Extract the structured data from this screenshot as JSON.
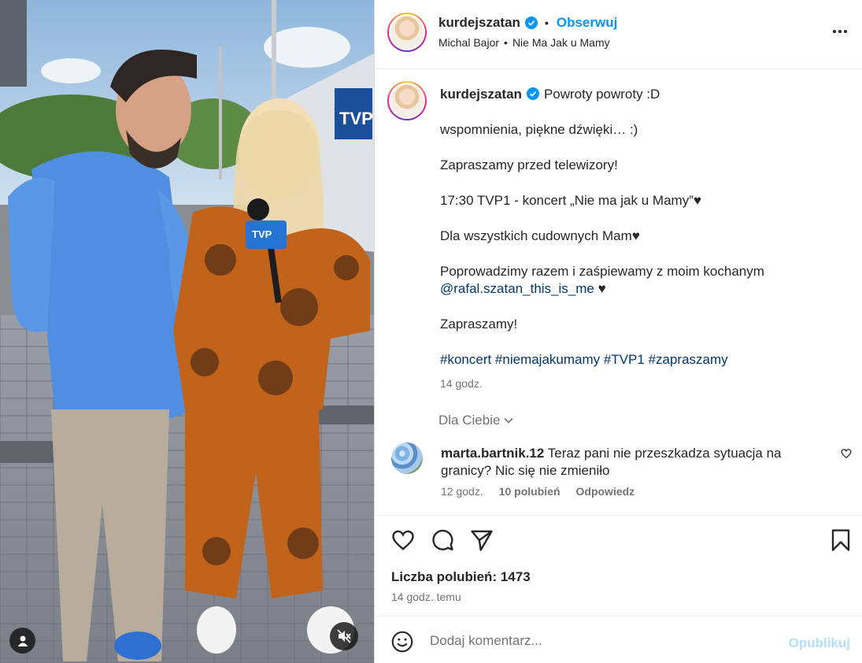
{
  "post": {
    "username": "kurdejszatan",
    "follow_label": "Obserwuj",
    "audio_artist": "Michal Bajor",
    "audio_title": "Nie Ma Jak u Mamy",
    "more_icon": "more-horizontal-icon"
  },
  "media": {
    "type": "video",
    "tag_icon": "person-tag-icon",
    "mute_icon": "muted-speaker-icon",
    "logo_text": "TVP",
    "mic_text": "TVP"
  },
  "caption": {
    "username": "kurdejszatan",
    "first_line": "Powroty powroty :D",
    "line2": "wspomnienia, piękne dźwięki… :)",
    "line3": "Zapraszamy przed telewizory!",
    "line4": "17:30 TVP1 - koncert „Nie ma jak u Mamy”♥",
    "line5": "Dla wszystkich cudownych Mam♥",
    "line6": "Poprowadzimy razem i zaśpiewamy z moim kochanym",
    "mention": "@rafal.szatan_this_is_me",
    "mention_suffix": " ♥",
    "line7": "Zapraszamy!",
    "hashtags": "#koncert #niemajakumamy #TVP1 #zapraszamy",
    "time": "14 godz."
  },
  "comments_filter": {
    "label": "Dla Ciebie",
    "icon": "chevron-down-icon"
  },
  "comment": {
    "username": "marta.bartnik.12",
    "text": "Teraz pani nie przeszkadza sytuacja na granicy? Nic się nie zmieniło",
    "time": "12 godz.",
    "likes": "10 polubień",
    "reply_label": "Odpowiedz"
  },
  "actions": {
    "likes_label": "Liczba polubień: 1473",
    "time_ago": "14 godz. temu"
  },
  "add_comment": {
    "placeholder": "Dodaj komentarz...",
    "publish_label": "Opublikuj"
  },
  "colors": {
    "accent": "#0095f6",
    "link": "#00376b",
    "muted": "#737373",
    "publish_disabled": "#b2dffc"
  }
}
